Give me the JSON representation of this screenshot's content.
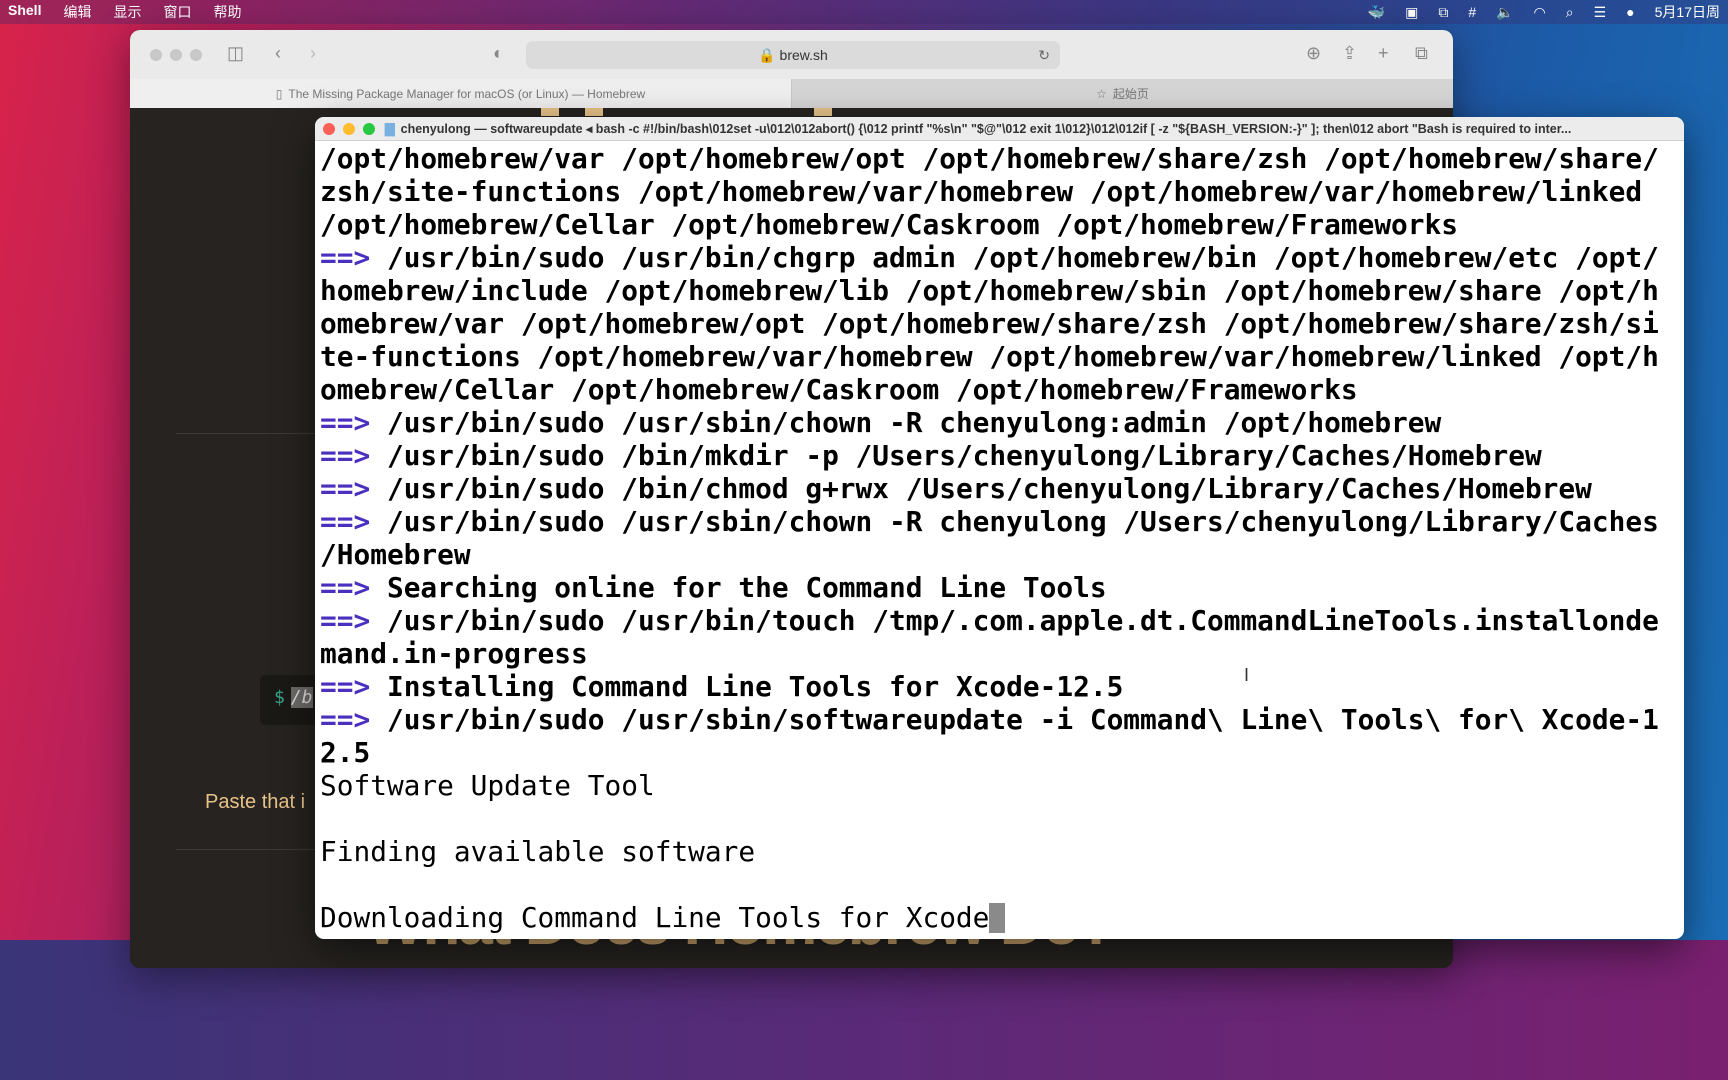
{
  "menubar": {
    "app": "Shell",
    "items": [
      "编辑",
      "显示",
      "窗口",
      "帮助"
    ],
    "clock": "5月17日周"
  },
  "browser": {
    "url": "brew.sh",
    "tabs": [
      {
        "label": "The Missing Package Manager for macOS (or Linux) — Homebrew"
      },
      {
        "label": "起始页"
      }
    ],
    "content": {
      "code_prompt": "$",
      "code_snippet": "/b",
      "paste_text": "Paste that i",
      "heading": "What Does Homebrew Do?"
    }
  },
  "terminal": {
    "title": "chenyulong — softwareupdate ◂ bash -c #!/bin/bash\\012set -u\\012\\012abort() {\\012  printf \"%s\\n\" \"$@\"\\012  exit 1\\012}\\012\\012if [ -z \"${BASH_VERSION:-}\" ]; then\\012  abort \"Bash is required to inter...",
    "arrow": "==>",
    "lines": [
      {
        "text": "/opt/homebrew/var /opt/homebrew/opt /opt/homebrew/share/zsh /opt/homebrew/share/",
        "bold": true
      },
      {
        "text": "zsh/site-functions /opt/homebrew/var/homebrew /opt/homebrew/var/homebrew/linked",
        "bold": true
      },
      {
        "text": "/opt/homebrew/Cellar /opt/homebrew/Caskroom /opt/homebrew/Frameworks",
        "bold": true
      },
      {
        "text": " /usr/bin/sudo /usr/bin/chgrp admin /opt/homebrew/bin /opt/homebrew/etc /opt/",
        "bold": true,
        "arrow": true
      },
      {
        "text": "homebrew/include /opt/homebrew/lib /opt/homebrew/sbin /opt/homebrew/share /opt/h",
        "bold": true
      },
      {
        "text": "omebrew/var /opt/homebrew/opt /opt/homebrew/share/zsh /opt/homebrew/share/zsh/si",
        "bold": true
      },
      {
        "text": "te-functions /opt/homebrew/var/homebrew /opt/homebrew/var/homebrew/linked /opt/h",
        "bold": true
      },
      {
        "text": "omebrew/Cellar /opt/homebrew/Caskroom /opt/homebrew/Frameworks",
        "bold": true
      },
      {
        "text": " /usr/bin/sudo /usr/sbin/chown -R chenyulong:admin /opt/homebrew",
        "bold": true,
        "arrow": true
      },
      {
        "text": " /usr/bin/sudo /bin/mkdir -p /Users/chenyulong/Library/Caches/Homebrew",
        "bold": true,
        "arrow": true
      },
      {
        "text": " /usr/bin/sudo /bin/chmod g+rwx /Users/chenyulong/Library/Caches/Homebrew",
        "bold": true,
        "arrow": true
      },
      {
        "text": " /usr/bin/sudo /usr/sbin/chown -R chenyulong /Users/chenyulong/Library/Caches",
        "bold": true,
        "arrow": true
      },
      {
        "text": "/Homebrew",
        "bold": true
      },
      {
        "text": " Searching online for the Command Line Tools",
        "bold": true,
        "arrow": true
      },
      {
        "text": " /usr/bin/sudo /usr/bin/touch /tmp/.com.apple.dt.CommandLineTools.installonde",
        "bold": true,
        "arrow": true
      },
      {
        "text": "mand.in-progress",
        "bold": true
      },
      {
        "text": " Installing Command Line Tools for Xcode-12.5",
        "bold": true,
        "arrow": true
      },
      {
        "text": " /usr/bin/sudo /usr/sbin/softwareupdate -i Command\\ Line\\ Tools\\ for\\ Xcode-1",
        "bold": true,
        "arrow": true
      },
      {
        "text": "2.5",
        "bold": true
      },
      {
        "text": "Software Update Tool",
        "bold": false
      },
      {
        "text": "",
        "bold": false
      },
      {
        "text": "Finding available software",
        "bold": false
      },
      {
        "text": "",
        "bold": false
      },
      {
        "text": "Downloading Command Line Tools for Xcode",
        "bold": false,
        "cursor": true
      }
    ]
  }
}
